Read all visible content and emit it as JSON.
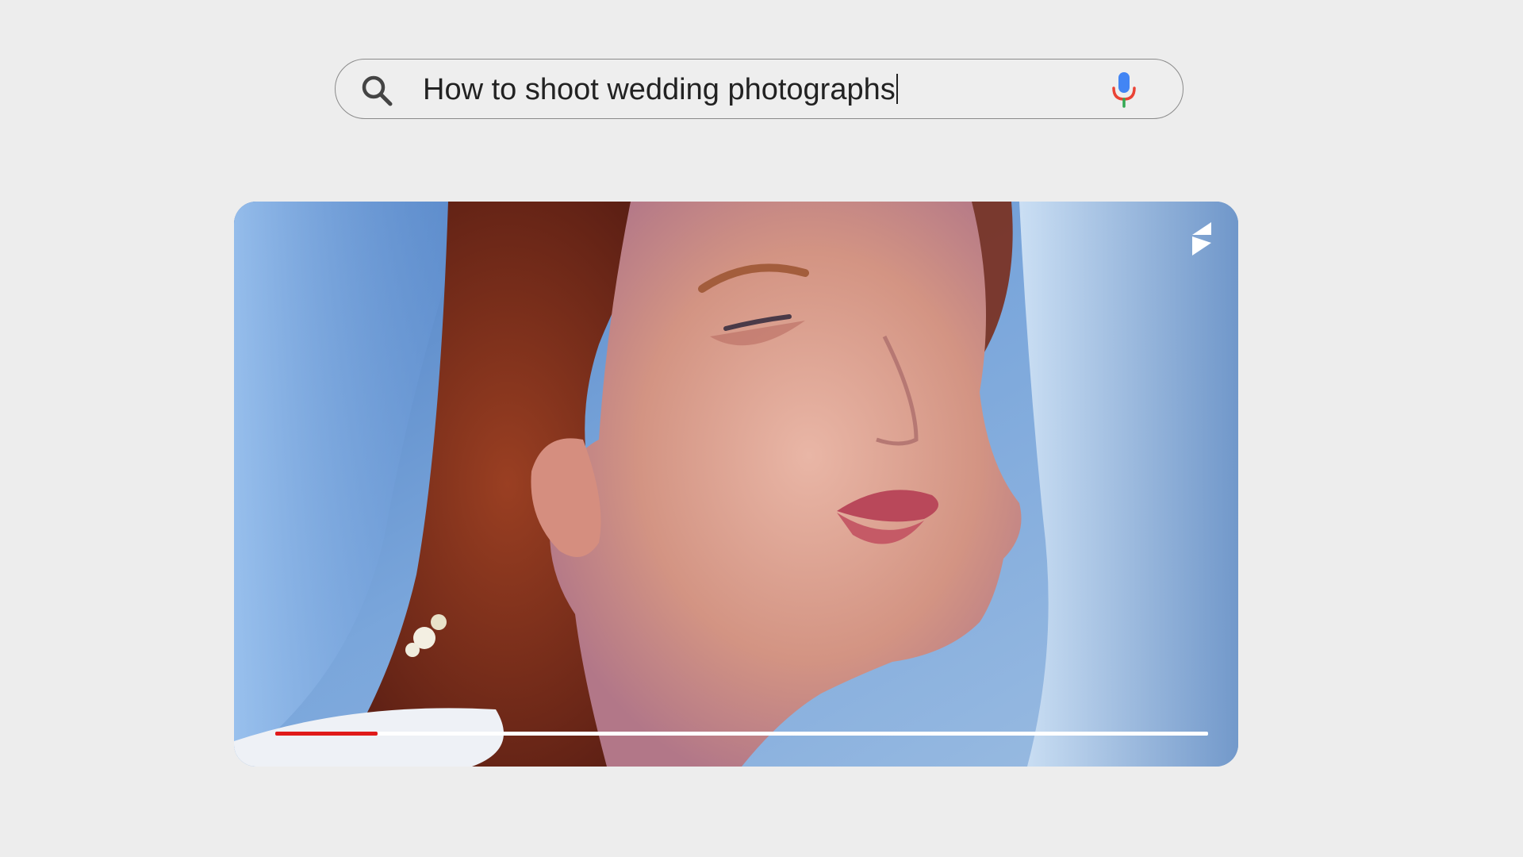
{
  "search": {
    "query": "How to shoot wedding photographs",
    "icon": "search-icon",
    "voice_icon": "mic-icon"
  },
  "player": {
    "brand_icon": "logo-icon",
    "progress": 0.11,
    "colors": {
      "progress_played": "#e01a1a",
      "progress_track": "#ffffff"
    }
  }
}
